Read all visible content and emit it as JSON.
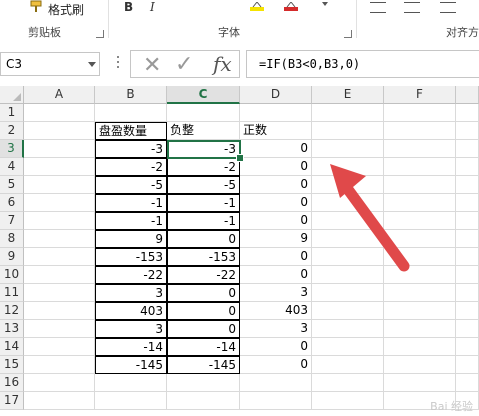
{
  "ribbon": {
    "format_painter": "格式刷",
    "groups": [
      "剪贴板",
      "字体",
      "对齐方"
    ],
    "bold": "B",
    "italic": "I",
    "icons": [
      "format-painter-icon",
      "bold-icon",
      "italic-icon",
      "fill-color-icon",
      "font-color-icon",
      "align-icon"
    ]
  },
  "formula_bar": {
    "name_box": "C3",
    "cancel": "✕",
    "confirm": "✓",
    "fx": "fx",
    "formula": "=IF(B3<0,B3,0)"
  },
  "grid": {
    "columns": [
      "A",
      "B",
      "C",
      "D",
      "E",
      "F"
    ],
    "active_column": "C",
    "rows": [
      "1",
      "2",
      "3",
      "4",
      "5",
      "6",
      "7",
      "8",
      "9",
      "10",
      "11",
      "12",
      "13",
      "14",
      "15",
      "16",
      "17"
    ],
    "active_row": "3",
    "headers": {
      "B": "盘盈数量",
      "C": "负整",
      "D": "正数"
    },
    "B": [
      "-3",
      "-2",
      "-5",
      "-1",
      "-1",
      "9",
      "-153",
      "-22",
      "3",
      "403",
      "3",
      "-14",
      "-145"
    ],
    "C": [
      "-3",
      "-2",
      "-5",
      "-1",
      "-1",
      "0",
      "-153",
      "-22",
      "0",
      "0",
      "0",
      "-14",
      "-145"
    ],
    "D": [
      "0",
      "0",
      "0",
      "0",
      "0",
      "9",
      "0",
      "0",
      "3",
      "403",
      "3",
      "0",
      "0"
    ],
    "selected_cell": "C3"
  },
  "annotation": {
    "arrow_color": "#e0494a"
  },
  "colors": {
    "accent": "#217346",
    "arrow": "#e0494a"
  },
  "watermark": "Bai 经验"
}
